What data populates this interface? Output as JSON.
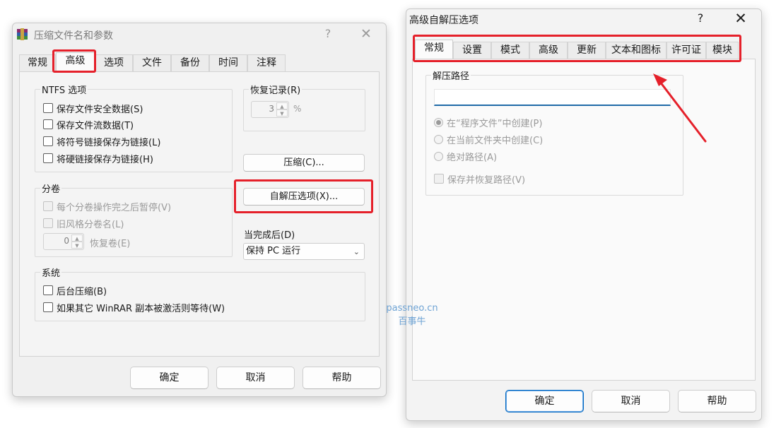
{
  "dialog1": {
    "title": "压缩文件名和参数",
    "help": "?",
    "close": "✕",
    "tabs": [
      "常规",
      "高级",
      "选项",
      "文件",
      "备份",
      "时间",
      "注释"
    ],
    "ntfs": {
      "title": "NTFS 选项",
      "items": [
        "保存文件安全数据(S)",
        "保存文件流数据(T)",
        "将符号链接保存为链接(L)",
        "将硬链接保存为链接(H)"
      ]
    },
    "recovery": {
      "title": "恢复记录(R)",
      "value": "3",
      "unit": "%"
    },
    "compress_button": "压缩(C)...",
    "sfx_button": "自解压选项(X)...",
    "volumes": {
      "title": "分卷",
      "items": [
        "每个分卷操作完之后暂停(V)",
        "旧风格分卷名(L)"
      ],
      "recovery_value": "0",
      "recovery_label": "恢复卷(E)"
    },
    "after_done": {
      "label": "当完成后(D)",
      "selected": "保持 PC 运行"
    },
    "system": {
      "title": "系统",
      "items": [
        "后台压缩(B)",
        "如果其它 WinRAR 副本被激活则等待(W)"
      ]
    },
    "footer": {
      "ok": "确定",
      "cancel": "取消",
      "help": "帮助"
    }
  },
  "dialog2": {
    "title": "高级自解压选项",
    "help": "?",
    "close": "✕",
    "tabs": [
      "常规",
      "设置",
      "模式",
      "高级",
      "更新",
      "文本和图标",
      "许可证",
      "模块"
    ],
    "path": {
      "title": "解压路径",
      "value": "",
      "radios": [
        "在“程序文件”中创建(P)",
        "在当前文件夹中创建(C)",
        "绝对路径(A)"
      ],
      "save_restore": "保存并恢复路径(V)"
    },
    "footer": {
      "ok": "确定",
      "cancel": "取消",
      "help": "帮助"
    }
  },
  "watermark": {
    "line1": "passneo.cn",
    "line2": "百事牛"
  },
  "colors": {
    "highlight": "#e5202a",
    "accent": "#0067c0",
    "watermark": "#6ea3d4"
  }
}
